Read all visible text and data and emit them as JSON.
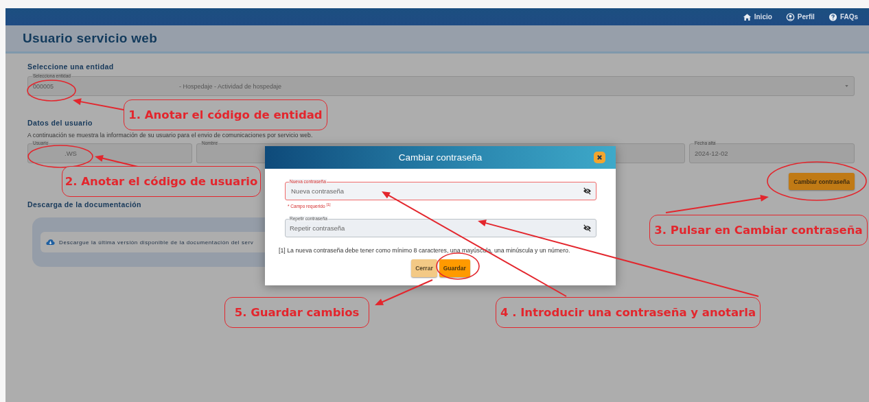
{
  "nav": [
    {
      "label": "Inicio",
      "kind": "home"
    },
    {
      "label": "Perfil",
      "kind": "user"
    },
    {
      "label": "FAQs",
      "kind": "help"
    }
  ],
  "page_title": "Usuario servicio web",
  "entity_section": {
    "heading": "Seleccione una entidad",
    "select": {
      "label": "Selecciona entidad",
      "value": "000005",
      "description": "- Hospedaje - Actividad de hospedaje"
    }
  },
  "user_section": {
    "heading": "Datos del usuario",
    "intro": "A continuación se muestra la información de su usuario para el envio de comunicaciones por servicio web.",
    "fields": [
      {
        "label": "Usuario",
        "value": ".WS"
      },
      {
        "label": "Nombre"
      },
      {
        "label": "Fecha alta",
        "value": "2024-12-02"
      }
    ],
    "change_password_button": "Cambiar contraseña"
  },
  "docs_section": {
    "heading": "Descarga de la documentación",
    "notice": "Descargue la última versión disponible de la documentación del serv"
  },
  "dialog": {
    "title": "Cambiar contraseña",
    "fields": [
      {
        "label": "Nueva contraseña",
        "placeholder": "Nueva contraseña",
        "invalid": true,
        "error": "* Campo requerido $^{[1]}$"
      },
      {
        "label": "Repetir contraseña",
        "placeholder": "Repetir contraseña",
        "invalid": false
      }
    ],
    "note": "[1] La nueva contraseña debe tener como mínimo 8 caracteres, una mayúscula, una minúscula y un número.",
    "buttons": [
      {
        "label": "Cerrar",
        "kind": "secondary"
      },
      {
        "label": "Guardar",
        "kind": "primary"
      }
    ]
  },
  "annotations": [
    {
      "text": "1. Anotar el código de entidad"
    },
    {
      "text": "2. Anotar el código de usuario"
    },
    {
      "text": "3. Pulsar en Cambiar contraseña"
    },
    {
      "text": "5. Guardar cambios"
    },
    {
      "text": "4 . Introducir una contraseña y anotarla"
    }
  ]
}
